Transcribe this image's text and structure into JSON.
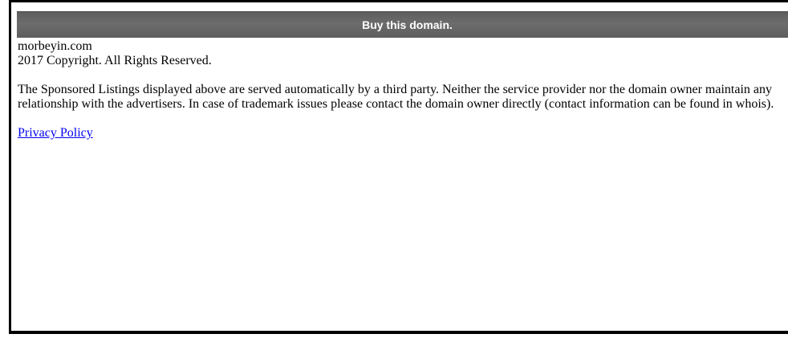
{
  "header": {
    "buy_label": "Buy this domain."
  },
  "main": {
    "domain_name": "morbeyin.com",
    "copyright": "2017 Copyright. All Rights Reserved.",
    "disclaimer": "The Sponsored Listings displayed above are served automatically by a third party. Neither the service provider nor the domain owner maintain any relationship with the advertisers. In case of trademark issues please contact the domain owner directly (contact information can be found in whois).",
    "privacy_label": "Privacy Policy"
  },
  "colors": {
    "bar_background": "#666666",
    "bar_text": "#ffffff",
    "link": "#0000ee",
    "text": "#000000"
  }
}
